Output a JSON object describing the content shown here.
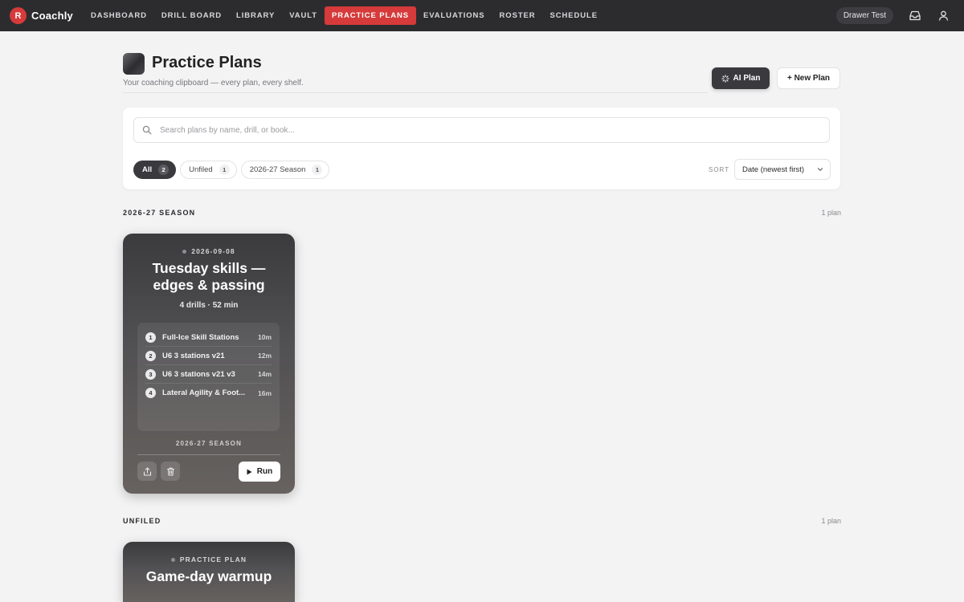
{
  "nav": {
    "brand_initial": "R",
    "brand_name": "Coachly",
    "items": [
      "DASHBOARD",
      "DRILL BOARD",
      "LIBRARY",
      "VAULT",
      "PRACTICE PLANS",
      "EVALUATIONS",
      "ROSTER",
      "SCHEDULE"
    ],
    "active": "PRACTICE PLANS",
    "user_label": "Drawer Test",
    "accent_color": "#d63a3a"
  },
  "header": {
    "title": "Practice Plans",
    "subtitle": "Your coaching clipboard — every plan, every shelf.",
    "ai_button": "AI Plan",
    "new_button": "+ New Plan"
  },
  "search": {
    "placeholder": "Search plans by name, drill, or book..."
  },
  "filters": {
    "chips": [
      {
        "label": "All",
        "count": "2",
        "active": true
      },
      {
        "label": "Unfiled",
        "count": "1",
        "active": false
      },
      {
        "label": "2026-27 Season",
        "count": "1",
        "active": false
      }
    ],
    "sort_label": "SORT",
    "sort_value": "Date (newest first)"
  },
  "sections": [
    {
      "title": "2026-27 SEASON",
      "count": "1 plan",
      "cards": [
        {
          "meta": "2026-09-08",
          "title": "Tuesday skills — edges & passing",
          "subtitle": "4 drills · 52 min",
          "drills": [
            {
              "num": "1",
              "name": "Full-Ice Skill Stations",
              "minutes": "10m"
            },
            {
              "num": "2",
              "name": "U6 3 stations v21",
              "minutes": "12m"
            },
            {
              "num": "3",
              "name": "U6 3 stations v21 v3",
              "minutes": "14m"
            },
            {
              "num": "4",
              "name": "Lateral Agility & Foot...",
              "minutes": "16m"
            }
          ],
          "season": "2026-27 SEASON",
          "run_label": "Run"
        }
      ]
    },
    {
      "title": "UNFILED",
      "count": "1 plan",
      "cards": [
        {
          "meta": "PRACTICE PLAN",
          "title": "Game-day warmup"
        }
      ]
    }
  ]
}
